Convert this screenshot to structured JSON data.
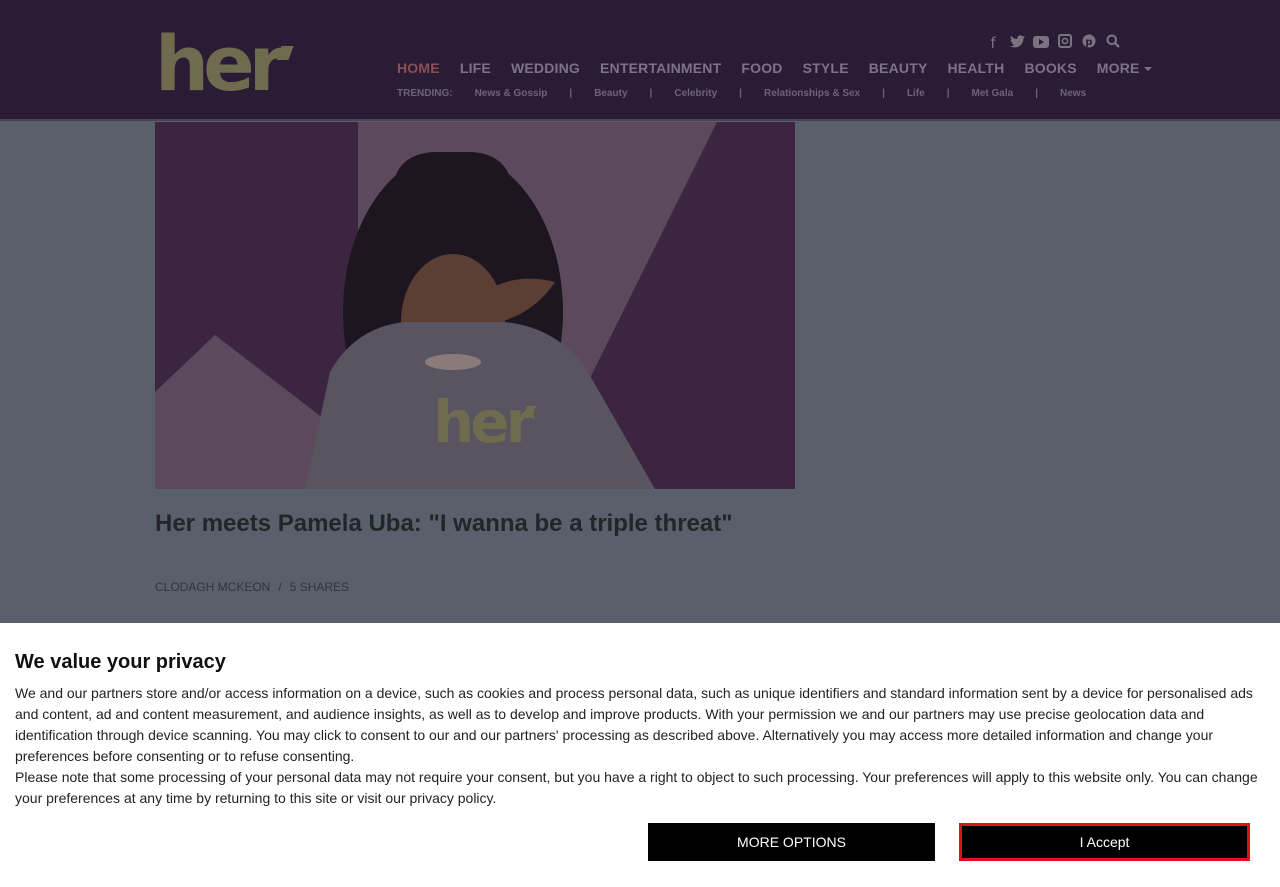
{
  "header": {
    "logo_text": "her",
    "nav": [
      {
        "label": "HOME",
        "active": true
      },
      {
        "label": "LIFE"
      },
      {
        "label": "WEDDING"
      },
      {
        "label": "ENTERTAINMENT"
      },
      {
        "label": "FOOD"
      },
      {
        "label": "STYLE"
      },
      {
        "label": "BEAUTY"
      },
      {
        "label": "HEALTH"
      },
      {
        "label": "BOOKS"
      },
      {
        "label": "MORE"
      }
    ],
    "social_icons": [
      "facebook-icon",
      "twitter-icon",
      "youtube-icon",
      "instagram-icon",
      "pinterest-icon",
      "search-icon"
    ],
    "trending": {
      "label": "TRENDING:",
      "items": [
        "News & Gossip",
        "Beauty",
        "Celebrity",
        "Relationships & Sex",
        "Life",
        "Met Gala",
        "News"
      ],
      "separator": "|"
    }
  },
  "article": {
    "hero_logo_text": "her",
    "title": "Her meets Pamela Uba: \"I wanna be a triple threat\"",
    "author": "CLODAGH MCKEON",
    "byline_separator": "/",
    "shares": "5 SHARES"
  },
  "consent": {
    "title": "We value your privacy",
    "paragraph1": "We and our partners store and/or access information on a device, such as cookies and process personal data, such as unique identifiers and standard information sent by a device for personalised ads and content, ad and content measurement, and audience insights, as well as to develop and improve products. With your permission we and our partners may use precise geolocation data and identification through device scanning. You may click to consent to our and our partners' processing as described above. Alternatively you may access more detailed information and change your preferences before consenting or to refuse consenting.",
    "paragraph2": "Please note that some processing of your personal data may not require your consent, but you have a right to object to such processing. Your preferences will apply to this website only. You can change your preferences at any time by returning to this site or visit our privacy policy.",
    "more_options_label": "MORE OPTIONS",
    "accept_label": "I Accept"
  },
  "colors": {
    "header_bg": "#2b1c36",
    "overlay": "#5a606b",
    "accept_border": "#e3101c"
  }
}
